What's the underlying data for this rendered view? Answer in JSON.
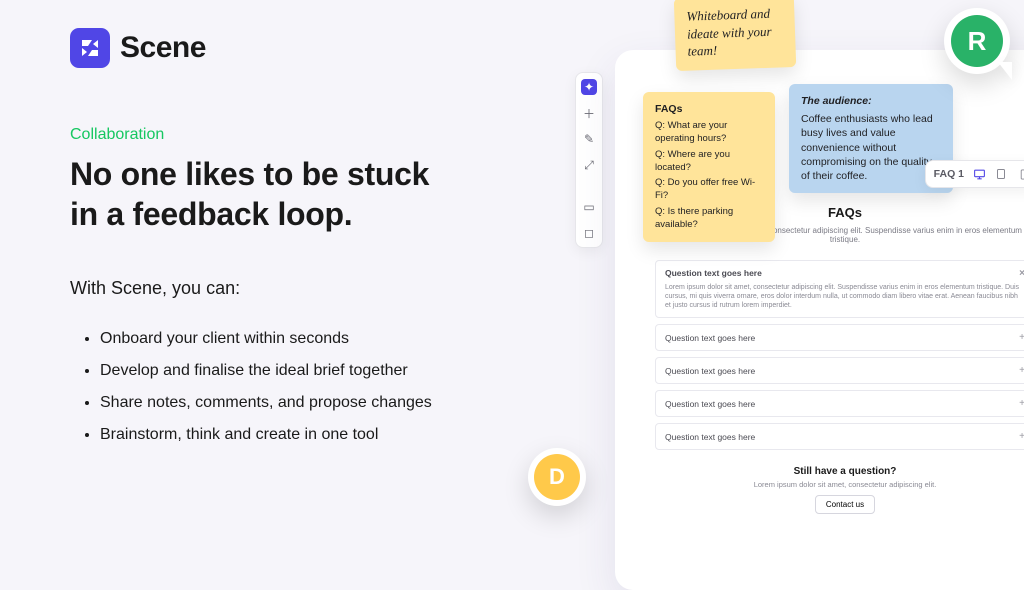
{
  "brand": {
    "name": "Scene"
  },
  "hero": {
    "eyebrow": "Collaboration",
    "headline_l1": "No one likes to be stuck",
    "headline_l2": "in a feedback loop.",
    "lede": "With Scene, you can:",
    "bullets": [
      "Onboard your client within seconds",
      "Develop and finalise the ideal brief together",
      "Share notes, comments, and propose changes",
      "Brainstorm, think and create in one tool"
    ]
  },
  "stickies": {
    "handwritten": "Whiteboard and ideate with your team!",
    "faq": {
      "title": "FAQs",
      "questions": [
        "Q: What are your operating hours?",
        "Q: Where are you located?",
        "Q: Do you offer free Wi-Fi?",
        "Q: Is there parking available?"
      ]
    },
    "audience": {
      "title": "The audience:",
      "body": "Coffee enthusiasts who lead busy lives and value convenience without compromising on the quality of their coffee."
    }
  },
  "devices": {
    "label": "FAQ 1"
  },
  "preview": {
    "section_title": "FAQs",
    "blurb": "Lorem ipsum dolor sit amet, consectetur adipiscing elit. Suspendisse varius enim in eros elementum tristique.",
    "open_q": "Question text goes here",
    "open_body": "Lorem ipsum dolor sit amet, consectetur adipiscing elit. Suspendisse varius enim in eros elementum tristique. Duis cursus, mi quis viverra ornare, eros dolor interdum nulla, ut commodo diam libero vitae erat. Aenean faucibus nibh et justo cursus id rutrum lorem imperdiet.",
    "closed_q": "Question text goes here",
    "cta_title": "Still have a question?",
    "cta_blurb": "Lorem ipsum dolor sit amet, consectetur adipiscing elit.",
    "cta_button": "Contact us"
  },
  "presence": {
    "r": "R",
    "d": "D"
  }
}
